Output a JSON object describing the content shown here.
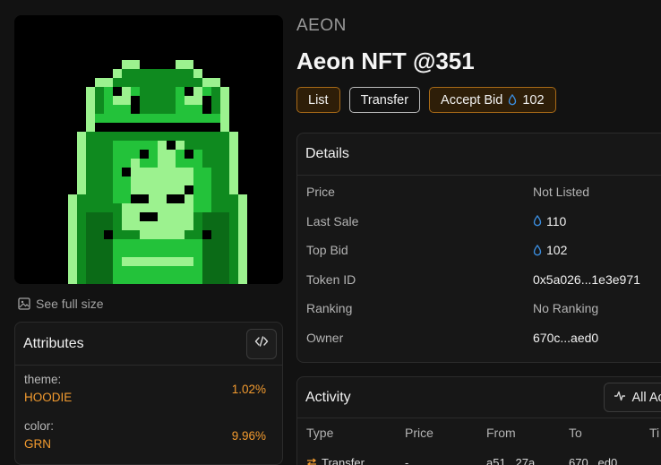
{
  "collection": "AEON",
  "title": "Aeon NFT @351",
  "buttons": {
    "list": "List",
    "transfer": "Transfer",
    "accept_bid": "Accept Bid",
    "bid_amount": "102"
  },
  "image": {
    "see_full_size": "See full size"
  },
  "attributes": {
    "title": "Attributes",
    "items": [
      {
        "key": "theme:",
        "value": "HOODIE",
        "percent": "1.02%"
      },
      {
        "key": "color:",
        "value": "GRN",
        "percent": "9.96%"
      }
    ]
  },
  "details": {
    "title": "Details",
    "rows": [
      {
        "label": "Price",
        "value": "Not Listed"
      },
      {
        "label": "Last Sale",
        "value": "110"
      },
      {
        "label": "Top Bid",
        "value": "102"
      },
      {
        "label": "Token ID",
        "value": "0x5a026...1e3e971"
      },
      {
        "label": "Ranking",
        "value": "No Ranking"
      },
      {
        "label": "Owner",
        "value": "670c...aed0"
      }
    ]
  },
  "activity": {
    "title": "Activity",
    "filter_label": "All Acti",
    "columns": [
      "Type",
      "Price",
      "From",
      "To",
      "Ti"
    ],
    "rows": [
      {
        "type": "Transfer",
        "price": "-",
        "from": "a51...27a",
        "to": "670...ed0"
      }
    ]
  },
  "colors": {
    "accent": "#f39b2f",
    "accent_border": "#a86a17",
    "drop_icon": "#3b8ee0",
    "background": "#121212",
    "panel": "#171717"
  },
  "icons": [
    "image-icon",
    "code-icon",
    "drop-icon",
    "activity-pulse-icon",
    "transfer-icon"
  ]
}
